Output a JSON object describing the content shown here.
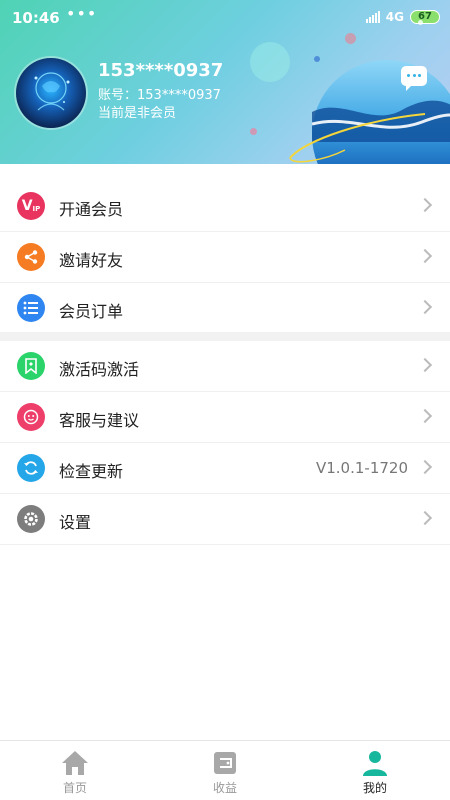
{
  "status_bar": {
    "time": "10:46",
    "dots": "•••",
    "network": "4G",
    "battery": "67"
  },
  "profile": {
    "phone": "153****0937",
    "account": "账号：153****0937",
    "member_status": "当前是非会员"
  },
  "menu": {
    "items": [
      {
        "label": "开通会员",
        "icon": "vip-icon",
        "color": "#e8345f"
      },
      {
        "label": "邀请好友",
        "icon": "share-icon",
        "color": "#f57c22"
      },
      {
        "label": "会员订单",
        "icon": "list-icon",
        "color": "#2f86f0"
      }
    ],
    "items2": [
      {
        "label": "激活码激活",
        "icon": "bookmark-icon",
        "color": "#2bd36b"
      },
      {
        "label": "客服与建议",
        "icon": "smile-icon",
        "color": "#ee3e6a"
      },
      {
        "label": "检查更新",
        "icon": "refresh-icon",
        "color": "#25a6e8",
        "value": "V1.0.1-1720"
      },
      {
        "label": "设置",
        "icon": "gear-icon",
        "color": "#7d7d7d"
      }
    ]
  },
  "bottom_nav": {
    "home": "首页",
    "earnings": "收益",
    "mine": "我的",
    "active_color": "#17b79d"
  }
}
